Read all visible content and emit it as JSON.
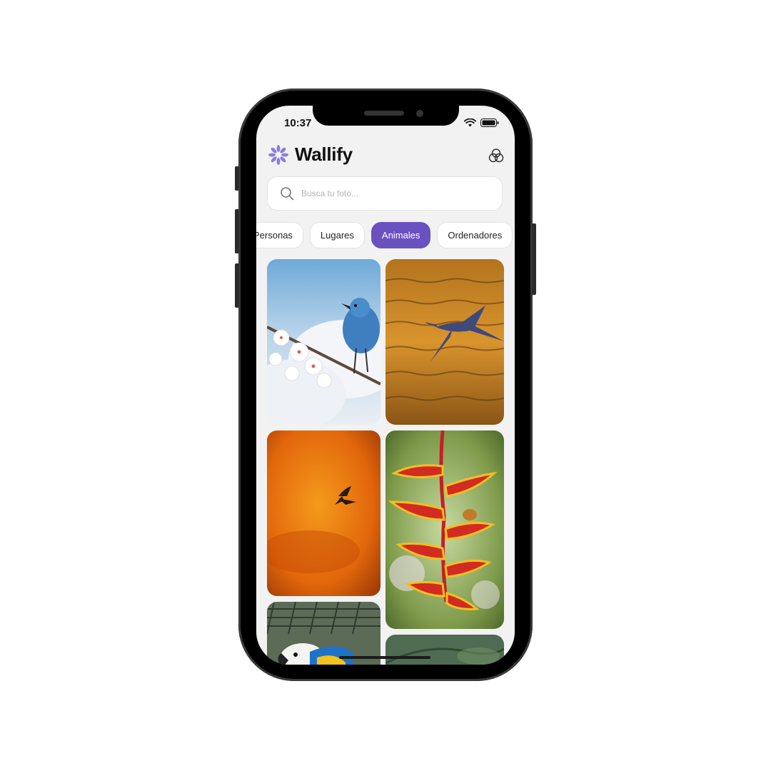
{
  "status_bar": {
    "time": "10:37"
  },
  "header": {
    "app_title": "Wallify"
  },
  "search": {
    "placeholder": "Busca tu foto..."
  },
  "categories": [
    {
      "label": "Personas",
      "selected": false
    },
    {
      "label": "Lugares",
      "selected": false
    },
    {
      "label": "Animales",
      "selected": true
    },
    {
      "label": "Ordenadores",
      "selected": false
    }
  ],
  "photos": [
    {
      "subject": "blue bird on blossom branch"
    },
    {
      "subject": "heron flying over golden water"
    },
    {
      "subject": "bird silhouette in orange sky"
    },
    {
      "subject": "frog on heliconia flower"
    },
    {
      "subject": "macaw behind wire fence"
    },
    {
      "subject": "green plant photo"
    }
  ],
  "theme": {
    "accent": "#6a51c0",
    "background": "#f2f2f2"
  }
}
